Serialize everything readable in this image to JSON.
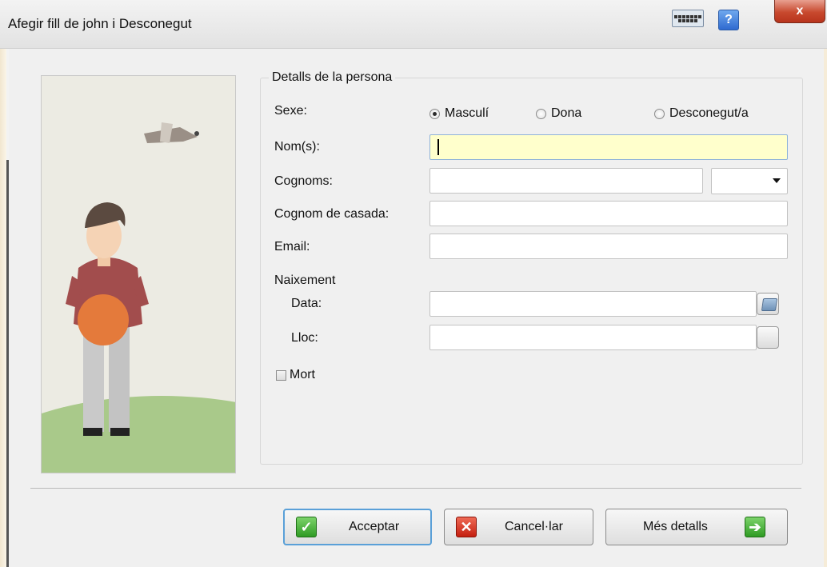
{
  "window": {
    "title": "Afegir fill de john i Desconegut",
    "keyboard_icon": "keyboard-icon",
    "help_icon": "help-icon",
    "help_label": "?",
    "close_label": "x"
  },
  "person_details": {
    "legend": "Detalls de la persona",
    "sex": {
      "label": "Sexe:",
      "options": [
        "Masculí",
        "Dona",
        "Desconegut/a"
      ],
      "selected": "Masculí"
    },
    "names": {
      "label": "Nom(s):",
      "value": ""
    },
    "surnames": {
      "label": "Cognoms:",
      "value": "",
      "suffix_value": ""
    },
    "married_name": {
      "label": "Cognom de casada:",
      "value": ""
    },
    "email": {
      "label": "Email:",
      "value": ""
    },
    "birth": {
      "heading": "Naixement",
      "date_label": "Data:",
      "date_value": "",
      "place_label": "Lloc:",
      "place_value": ""
    },
    "deceased": {
      "label": "Mort",
      "checked": false
    }
  },
  "buttons": {
    "accept": "Acceptar",
    "cancel": "Cancel·lar",
    "more": "Més detalls"
  },
  "colors": {
    "focused_field": "#ffffcc",
    "accept_icon": "#2f9b24",
    "cancel_icon": "#c41f10"
  }
}
